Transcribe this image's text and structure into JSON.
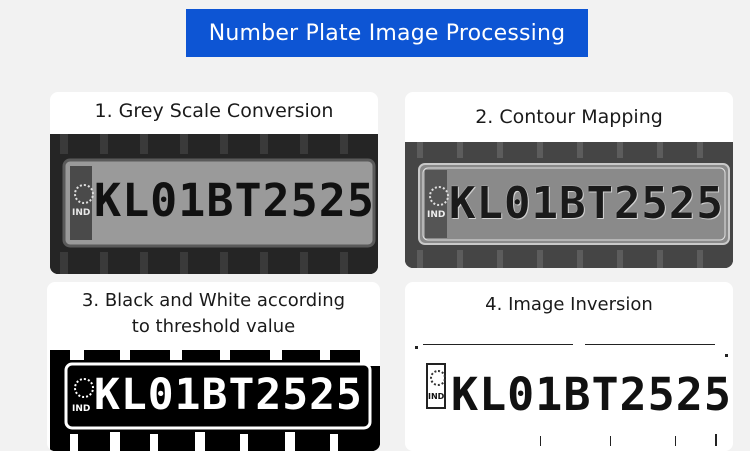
{
  "header": {
    "title": "Number Plate Image Processing"
  },
  "panels": [
    {
      "title": "1. Grey Scale Conversion",
      "plate": "KL01BT2525",
      "badge": "IND"
    },
    {
      "title": "2. Contour Mapping",
      "plate": "KL01BT2525",
      "badge": "IND"
    },
    {
      "title": "3. Black and White according to threshold value",
      "plate": "KL01BT2525",
      "badge": "IND"
    },
    {
      "title": "4. Image Inversion",
      "plate": "KL01BT2525",
      "badge": "IND"
    }
  ]
}
